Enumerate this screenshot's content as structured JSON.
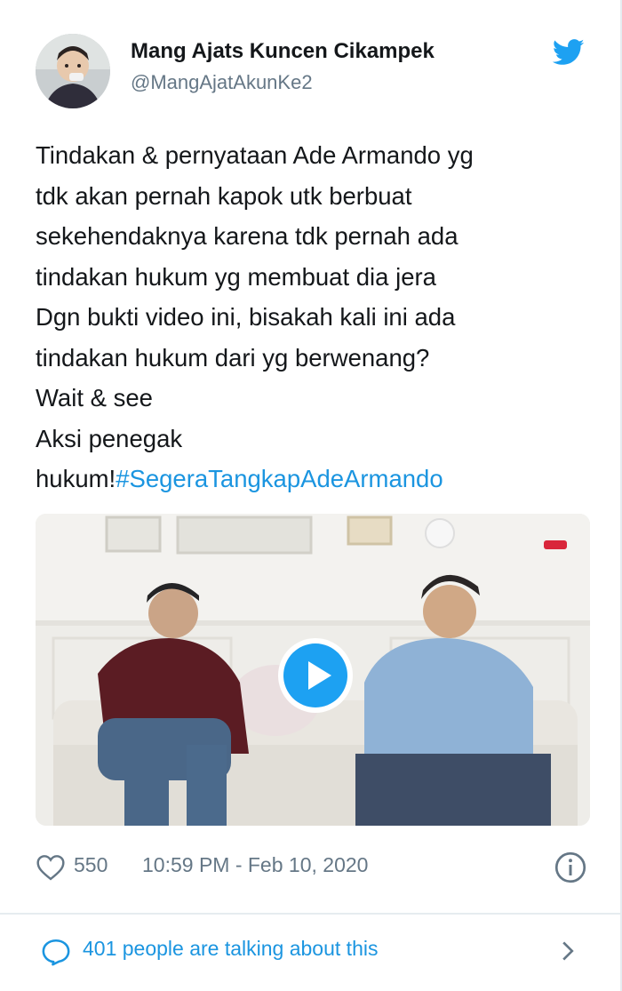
{
  "user": {
    "name": "Mang Ajats Kuncen Cikampek",
    "handle": "@MangAjatAkunKe2"
  },
  "tweet": {
    "lines": [
      "Tindakan & pernyataan Ade Armando yg",
      "tdk akan pernah kapok utk berbuat",
      "sekehendaknya karena tdk pernah ada",
      "tindakan hukum yg membuat dia jera",
      "Dgn bukti video ini, bisakah kali ini ada",
      "tindakan hukum dari yg berwenang?",
      "Wait & see",
      "Aksi penegak"
    ],
    "last_line_prefix": "hukum!",
    "hashtag": "#SegeraTangkapAdeArmando"
  },
  "meta": {
    "likes": "550",
    "timestamp": "10:59 PM - Feb 10, 2020"
  },
  "footer": {
    "talking_label": "401 people are talking about this"
  },
  "colors": {
    "accent": "#1da1f2",
    "link": "#1b95e0",
    "muted": "#657786",
    "text": "#14171a"
  }
}
